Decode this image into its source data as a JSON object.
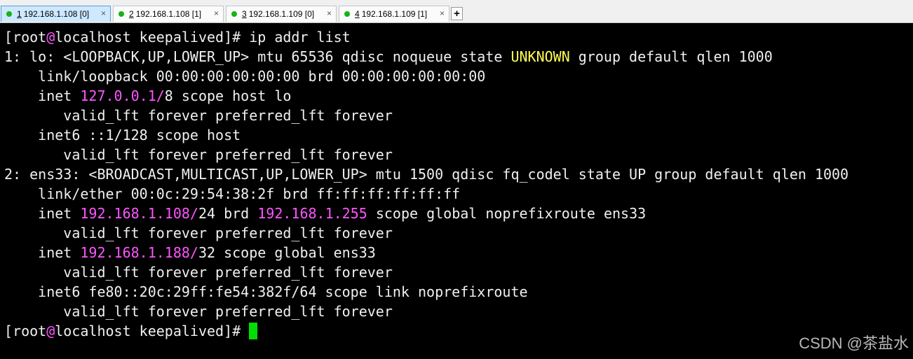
{
  "tabs": [
    {
      "num": "1",
      "label": "192.168.1.108 [0]",
      "close": "×",
      "active": true
    },
    {
      "num": "2",
      "label": "192.168.1.108 [1]",
      "close": "×",
      "active": false
    },
    {
      "num": "3",
      "label": "192.168.1.109 [0]",
      "close": "×",
      "active": false
    },
    {
      "num": "4",
      "label": "192.168.1.109 [1]",
      "close": "×",
      "active": false
    }
  ],
  "add_tab": "+",
  "colors": {
    "prompt_at": "#ff55ff",
    "ip_address": "#ff55ff",
    "state_warn": "#ffff55",
    "cursor": "#00e000",
    "status_dot": "#16b316"
  },
  "terminal": {
    "prompt": {
      "open": "[root",
      "at": "@",
      "host": "localhost keepalived]# "
    },
    "command": "ip addr list",
    "lines": {
      "l01a": "1: lo: <LOOPBACK,UP,LOWER_UP> mtu 65536 qdisc noqueue state ",
      "l01b": "UNKNOWN",
      "l01c": " group default qlen 1000",
      "l02": "    link/loopback 00:00:00:00:00:00 brd 00:00:00:00:00:00",
      "l03a": "    inet ",
      "l03b": "127.0.0.1/",
      "l03c": "8 scope host lo",
      "l04": "       valid_lft forever preferred_lft forever",
      "l05": "    inet6 ::1/128 scope host",
      "l06": "       valid_lft forever preferred_lft forever",
      "l07": "2: ens33: <BROADCAST,MULTICAST,UP,LOWER_UP> mtu 1500 qdisc fq_codel state UP group default qlen 1000",
      "l08": "    link/ether 00:0c:29:54:38:2f brd ff:ff:ff:ff:ff:ff",
      "l09a": "    inet ",
      "l09b": "192.168.1.108/",
      "l09c": "24 brd ",
      "l09d": "192.168.1.255",
      "l09e": " scope global noprefixroute ens33",
      "l10": "       valid_lft forever preferred_lft forever",
      "l11a": "    inet ",
      "l11b": "192.168.1.188/",
      "l11c": "32 scope global ens33",
      "l12": "       valid_lft forever preferred_lft forever",
      "l13": "    inet6 fe80::20c:29ff:fe54:382f/64 scope link noprefixroute",
      "l14": "       valid_lft forever preferred_lft forever"
    }
  },
  "watermark": "CSDN @茶盐水"
}
